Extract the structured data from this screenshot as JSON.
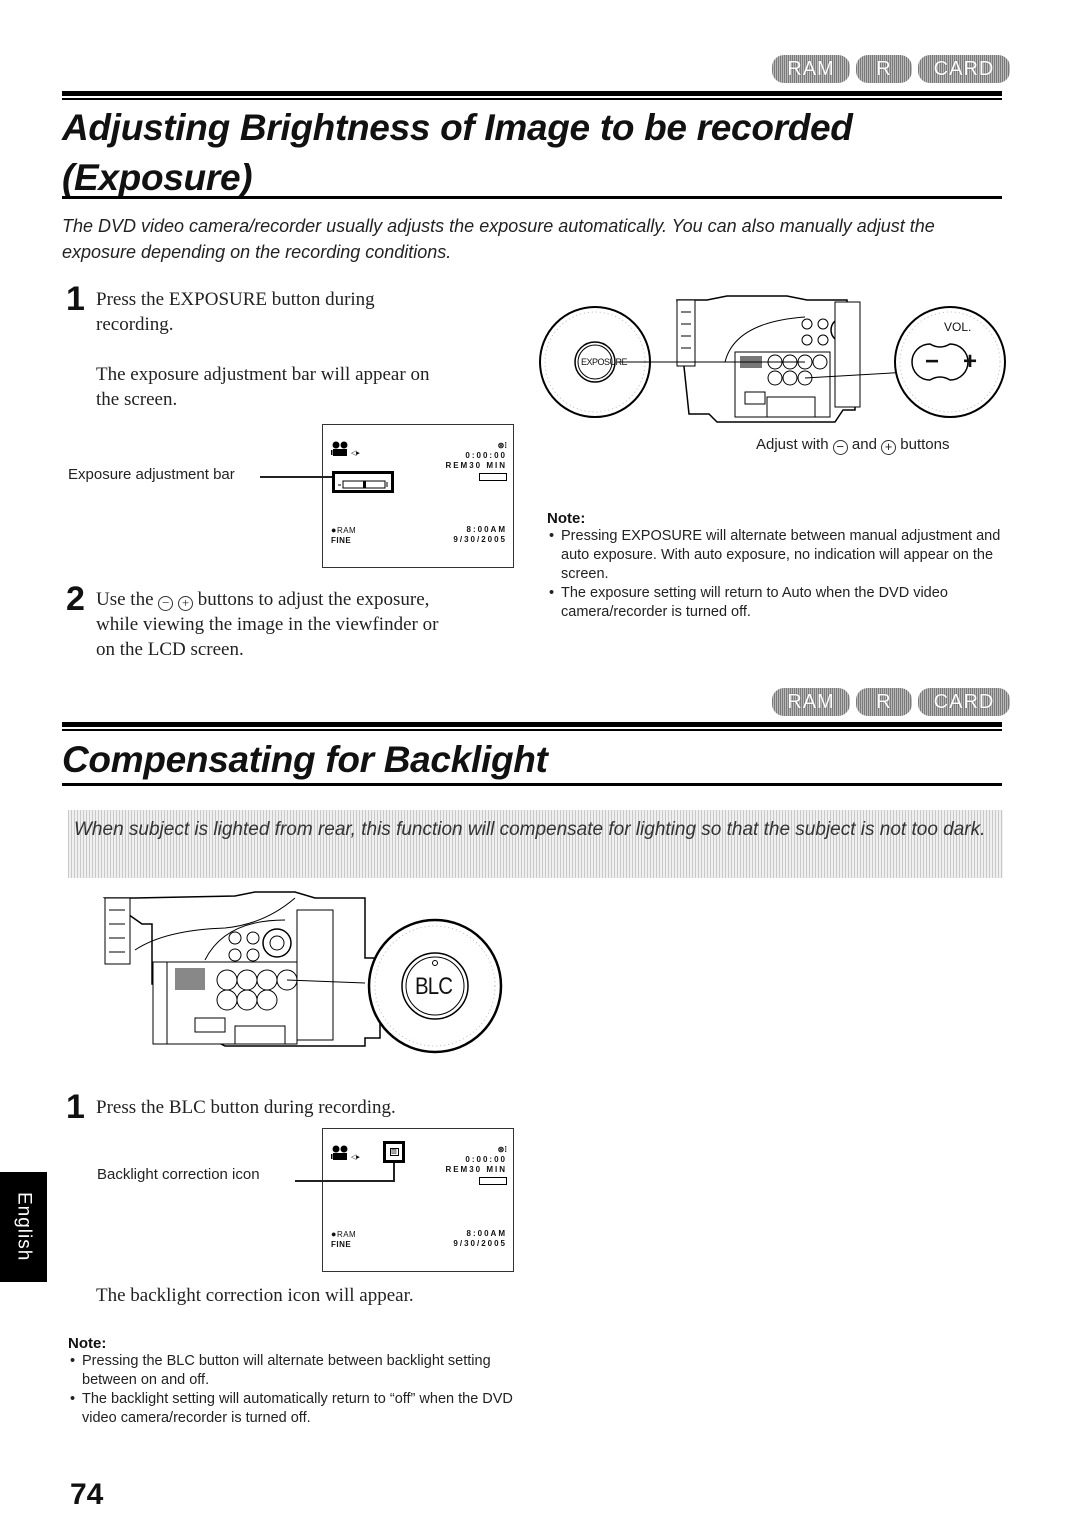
{
  "media_badges": [
    "RAM",
    "R",
    "CARD"
  ],
  "section1": {
    "title": "Adjusting Brightness of Image to be recorded (Exposure)",
    "title_line1": "Adjusting Brightness of Image to be recorded",
    "title_line2": "(Exposure)",
    "lead": "The DVD video camera/recorder usually adjusts the exposure automatically. You can also manually adjust the exposure depending on the recording conditions.",
    "step1": {
      "number": "1",
      "line1": "Press the EXPOSURE button during",
      "line2": "recording.",
      "result_line1": "The exposure adjustment bar will appear on",
      "result_line2": "the screen."
    },
    "screen_callout": "Exposure adjustment bar",
    "step2": {
      "number": "2",
      "line1_prefix": "Use the",
      "line1_suffix": "buttons to adjust the exposure,",
      "line2": "while viewing the image in the viewfinder or",
      "line3": "on the LCD screen."
    },
    "illustration": {
      "exposure_button_label": "EXPOSURE",
      "vol_label": "VOL.",
      "minus_label": "−",
      "plus_label": "+",
      "caption_prefix": "Adjust with",
      "caption_mid": "and",
      "caption_suffix": "buttons"
    },
    "note": {
      "title": "Note:",
      "items": [
        "Pressing EXPOSURE will alternate between manual adjustment and auto exposure. With auto exposure, no indication will appear on the screen.",
        "The exposure setting will return to Auto when the DVD video camera/recorder is turned off."
      ]
    }
  },
  "lcd_screen": {
    "counter": "0:00:00",
    "remaining": "REM30 MIN",
    "disc": "RAM",
    "quality": "FINE",
    "time": "8:00AM",
    "date": "9/30/2005"
  },
  "section2": {
    "title": "Compensating for Backlight",
    "band_text": "When subject is lighted from rear, this function will compensate for lighting so that the subject is not too dark.",
    "illustration": {
      "blc_label": "BLC"
    },
    "step1": {
      "number": "1",
      "text": "Press the BLC button during recording.",
      "result": "The backlight correction icon will appear."
    },
    "screen_callout": "Backlight correction icon",
    "note": {
      "title": "Note:",
      "items": [
        "Pressing the BLC button will alternate between backlight setting between on and off.",
        "The backlight setting will automatically return to “off” when the DVD video camera/recorder is turned off."
      ]
    }
  },
  "side_tab": "English",
  "page_number": "74",
  "glyphs": {
    "minus_circle": "−",
    "plus_circle": "+"
  }
}
